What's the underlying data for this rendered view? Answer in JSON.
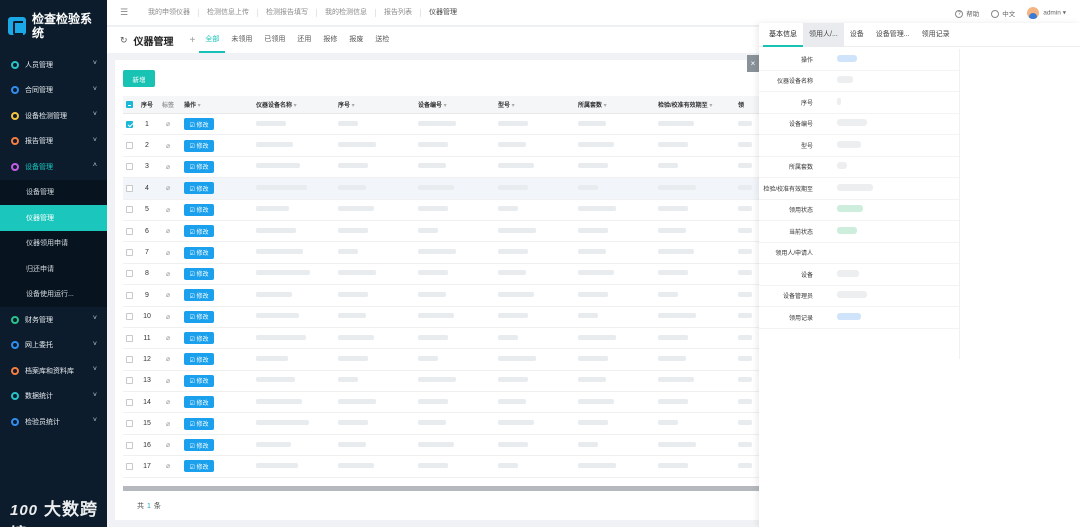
{
  "brand": {
    "title": "检查检验系统"
  },
  "sidebar": {
    "items": [
      {
        "label": "人员管理",
        "color": "#29c2c6"
      },
      {
        "label": "合同管理",
        "color": "#2f8ff0"
      },
      {
        "label": "设备检测管理",
        "color": "#f5c242"
      },
      {
        "label": "报告管理",
        "color": "#f57c42"
      },
      {
        "label": "设备管理",
        "color": "#c35ee8"
      }
    ],
    "sub_items": [
      {
        "label": "设备管理"
      },
      {
        "label": "仪器管理"
      },
      {
        "label": "仪器领用申请"
      },
      {
        "label": "归还申请"
      },
      {
        "label": "设备使用运行..."
      }
    ],
    "items_after": [
      {
        "label": "财务管理",
        "color": "#29c48a"
      },
      {
        "label": "网上委托",
        "color": "#2f8ff0"
      },
      {
        "label": "档案库和资料库",
        "color": "#f57c42"
      },
      {
        "label": "数据统计",
        "color": "#29c2c6"
      },
      {
        "label": "检验员统计",
        "color": "#2f8ff0"
      }
    ]
  },
  "topbar": {
    "tabs": [
      "我的申领仪器",
      "检测信息上传",
      "检测报告填写",
      "我的检测信息",
      "报告列表",
      "仪器管理"
    ],
    "help": "帮助",
    "lang": "中文",
    "user": "admin"
  },
  "subhead": {
    "title": "仪器管理",
    "tabs": [
      "全部",
      "未领用",
      "已领用",
      "还用",
      "报修",
      "报废",
      "送检"
    ]
  },
  "toolbar": {
    "new_label": "新增"
  },
  "table": {
    "headers": {
      "no": "序号",
      "tag": "标签",
      "op": "操作",
      "name": "仪器设备名称",
      "seq": "序号",
      "code": "设备编号",
      "model": "型号",
      "room": "所属套数",
      "valid": "检验/校准有效期至",
      "last": "领"
    },
    "edit_label": "修改",
    "rows": [
      "1",
      "2",
      "3",
      "4",
      "5",
      "6",
      "7",
      "8",
      "9",
      "10",
      "11",
      "12",
      "13",
      "14",
      "15",
      "16",
      "17"
    ]
  },
  "pager": {
    "prefix": "共",
    "count": "1",
    "suffix": "条"
  },
  "panel": {
    "tabs": [
      "基本信息",
      "领用人/...",
      "设备",
      "设备管理...",
      "领用记录"
    ],
    "fields": [
      "操作",
      "仪器设备名称",
      "序号",
      "设备编号",
      "型号",
      "所属套数",
      "检验/校准有效期至",
      "领用状态",
      "当前状态",
      "领用人/申请人",
      "设备",
      "设备管理员",
      "领用记录"
    ],
    "close_icon": "close-icon"
  },
  "watermark": {
    "logo": "100",
    "text": "大数跨境"
  },
  "colors": {
    "accent": "#19c3b3",
    "sidebar": "#0c1c2c",
    "edit": "#1aa0ec"
  }
}
